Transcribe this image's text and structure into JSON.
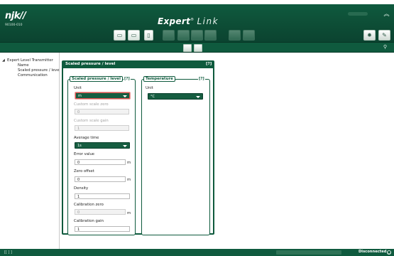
{
  "header": {
    "brand": "njk//",
    "brand_sub": "90100-010",
    "app_title_main": "Expert",
    "app_title_sup": "®",
    "app_title_link": "Link",
    "collapse_glyph": "︽"
  },
  "toolbar": {
    "icons": [
      "folder-open-icon",
      "save-icon",
      "document-icon",
      "device-icon",
      "chart-icon",
      "edit-icon",
      "tools-icon",
      "check-icon",
      "settings-gear-icon",
      "edit-settings-icon"
    ]
  },
  "subtoolbar": {
    "icons": [
      "copy-icon",
      "paste-icon",
      "pin-icon"
    ]
  },
  "tree": {
    "root": "Expert Level Transmitter",
    "children": [
      "Name",
      "Scaled pressure / level",
      "Communication"
    ]
  },
  "panel": {
    "title": "Scaled pressure / level",
    "help": "[?]",
    "group_scaled": {
      "legend": "Scaled pressure / level",
      "help": "[?]",
      "unit_label": "Unit",
      "unit_value": "m",
      "custom_zero_label": "Custom scale zero",
      "custom_zero_value": "0",
      "custom_gain_label": "Custom scale gain",
      "custom_gain_value": "1",
      "avg_time_label": "Average time",
      "avg_time_value": "1s",
      "error_label": "Error value",
      "error_value": "0",
      "error_unit": "m",
      "zero_offset_label": "Zero offset",
      "zero_offset_value": "0",
      "zero_offset_unit": "m",
      "density_label": "Density",
      "density_value": "1",
      "cal_zero_label": "Calibration zero",
      "cal_zero_value": "0",
      "cal_zero_unit": "m",
      "cal_gain_label": "Calibration gain",
      "cal_gain_value": "1"
    },
    "group_temp": {
      "legend": "Temperature",
      "help": "[?]",
      "unit_label": "Unit",
      "unit_value": "°C"
    }
  },
  "status": {
    "left": "[[ ] ]",
    "connection": "Disconnected"
  },
  "colors": {
    "brand_green": "#0f5a3e",
    "error_border": "#d9534f"
  }
}
